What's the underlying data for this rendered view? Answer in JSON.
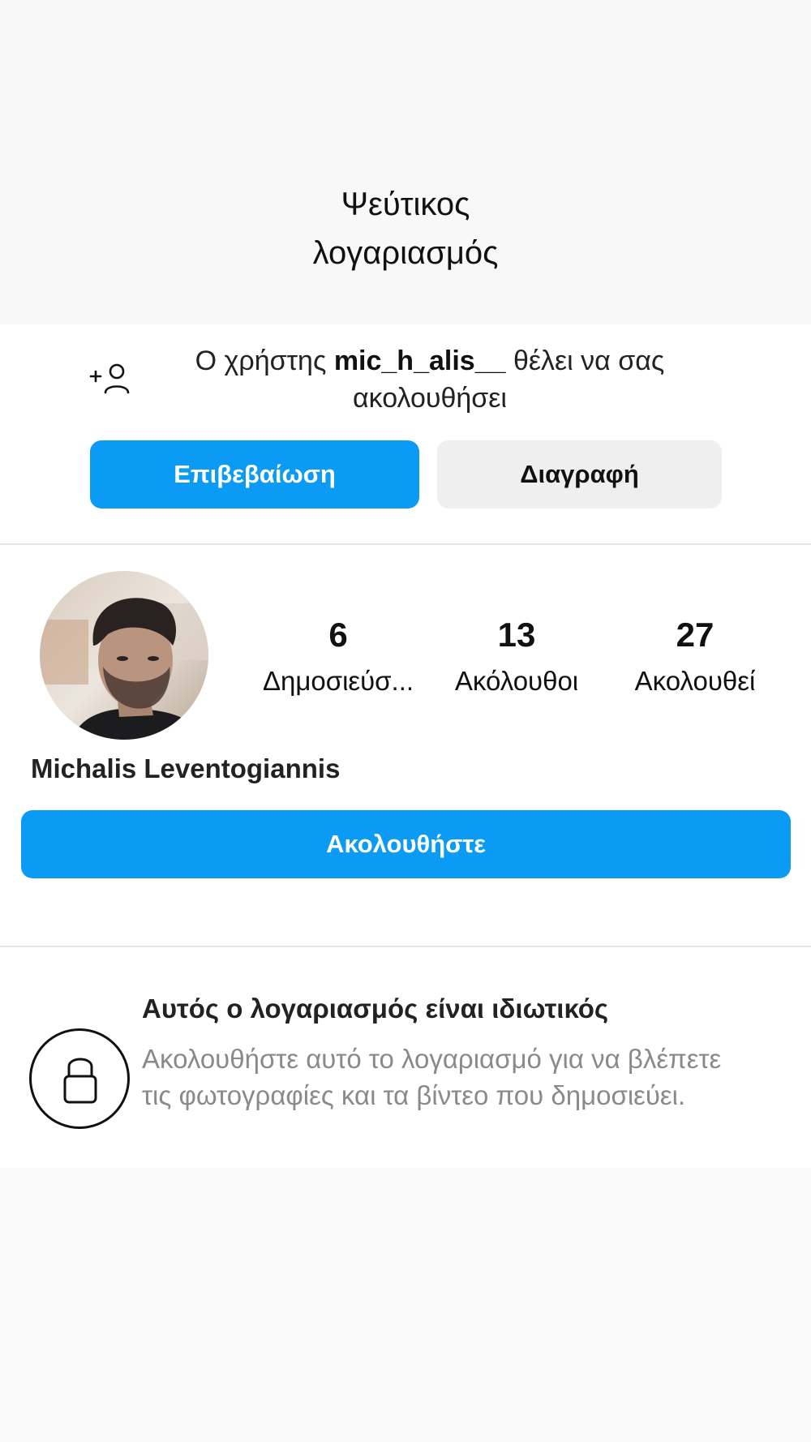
{
  "caption": {
    "line1": "Ψεύτικος",
    "line2": "λογαριασμός"
  },
  "follow_request": {
    "icon": "add-person-icon",
    "text_prefix": "Ο χρήστης ",
    "username": "mic_h_alis__",
    "text_suffix": " θέλει να σας ακολουθήσει",
    "confirm_label": "Επιβεβαίωση",
    "delete_label": "Διαγραφή"
  },
  "profile": {
    "avatar": "profile-photo",
    "full_name": "Michalis Leventogiannis",
    "stats": {
      "posts": {
        "count": "6",
        "label": "Δημοσιεύσ..."
      },
      "followers": {
        "count": "13",
        "label": "Ακόλουθοι"
      },
      "following": {
        "count": "27",
        "label": "Ακολουθεί"
      }
    },
    "follow_label": "Ακολουθήστε"
  },
  "private_notice": {
    "icon": "lock-icon",
    "title": "Αυτός ο λογαριασμός είναι ιδιωτικός",
    "description": "Ακολουθήστε αυτό το λογαριασμό για να βλέπετε τις φωτογραφίες και τα βίντεο που δημοσιεύει."
  },
  "colors": {
    "accent": "#0b9bf5",
    "secondary_button": "#efefef",
    "muted_text": "#8a8a8a"
  }
}
